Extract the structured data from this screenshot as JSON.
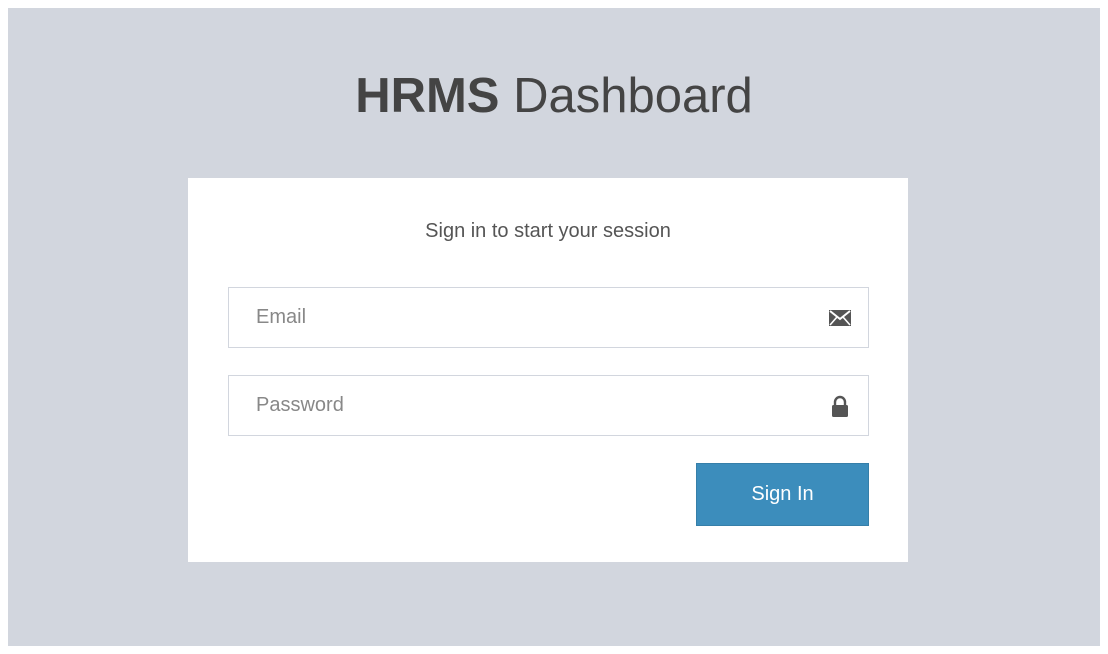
{
  "logo": {
    "strong": "HRMS",
    "light": " Dashboard"
  },
  "login": {
    "message": "Sign in to start your session",
    "email_placeholder": "Email",
    "email_value": "",
    "password_placeholder": "Password",
    "password_value": "",
    "submit_label": "Sign In"
  },
  "icons": {
    "email": "envelope-icon",
    "password": "lock-icon"
  },
  "colors": {
    "page_background": "#d2d6de",
    "box_background": "#ffffff",
    "primary_button": "#3c8dbc",
    "icon": "#555555"
  }
}
